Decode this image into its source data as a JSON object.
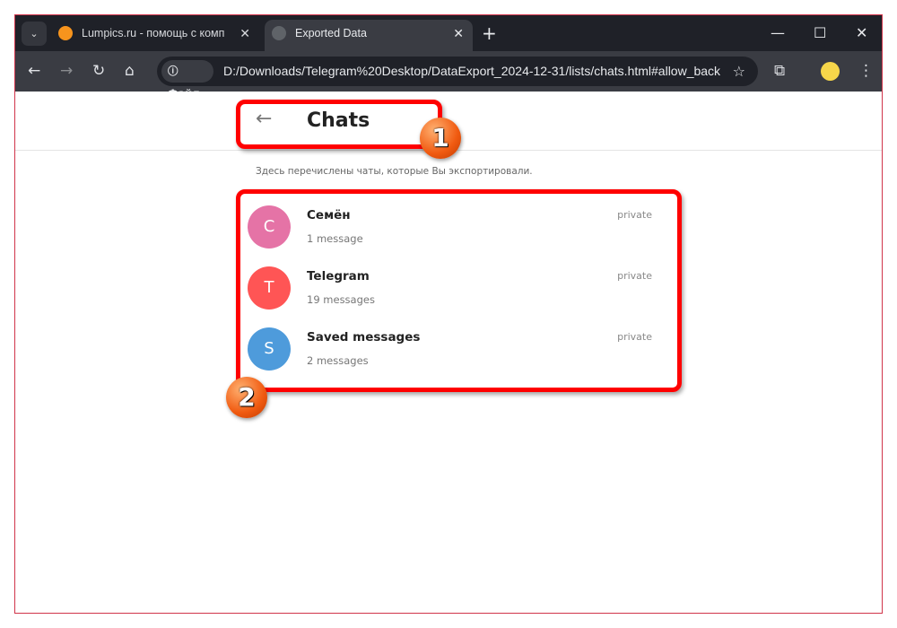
{
  "browser": {
    "tabs": [
      {
        "title": "Lumpics.ru - помощь с компьютером",
        "active": false
      },
      {
        "title": "Exported Data",
        "active": true
      }
    ],
    "new_tab": "+",
    "site_chip": "Файл",
    "url": "D:/Downloads/Telegram%20Desktop/DataExport_2024-12-31/lists/chats.html#allow_back"
  },
  "page": {
    "title": "Chats",
    "description": "Здесь перечислены чаты, которые Вы экспортировали.",
    "chats": [
      {
        "initial": "С",
        "name": "Семён",
        "count": "1 message",
        "type": "private",
        "color": "#e573a6"
      },
      {
        "initial": "T",
        "name": "Telegram",
        "count": "19 messages",
        "type": "private",
        "color": "#ff5555"
      },
      {
        "initial": "S",
        "name": "Saved messages",
        "count": "2 messages",
        "type": "private",
        "color": "#4e9bdb"
      }
    ]
  },
  "annotations": [
    "1",
    "2"
  ]
}
